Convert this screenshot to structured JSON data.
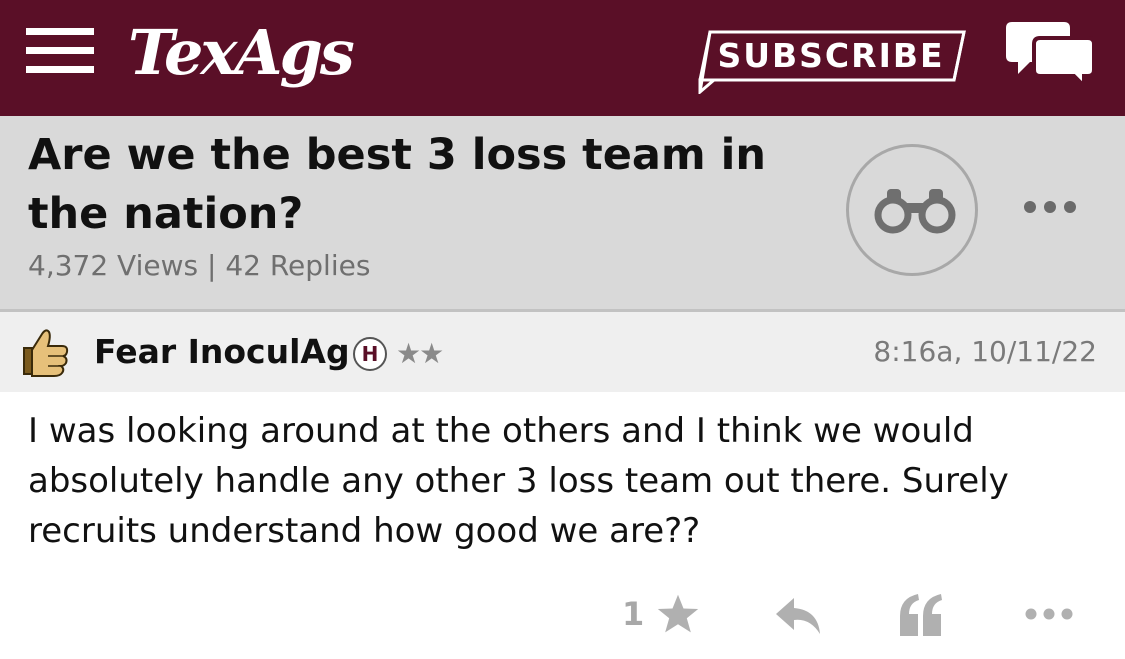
{
  "header": {
    "logo_text": "TexAgs",
    "subscribe_label": "SUBSCRIBE",
    "brand_color": "#5a0f27",
    "menu_icon": "hamburger-icon",
    "chat_icon": "chat-bubbles-icon"
  },
  "thread": {
    "title": "Are we the best 3 loss team in the nation?",
    "stats": "4,372 Views | 42 Replies",
    "watch_icon": "binoculars-icon",
    "more_icon": "more-dots-icon"
  },
  "post": {
    "author": "Fear InoculAg",
    "badge": "H",
    "stars": "★★",
    "timestamp": "8:16a, 10/11/22",
    "body": "I was looking around at the others and I think we would absolutely handle any other 3 loss team out there. Surely recruits understand how good we are??",
    "star_count": "1",
    "avatar_icon": "thumbs-up-icon"
  }
}
